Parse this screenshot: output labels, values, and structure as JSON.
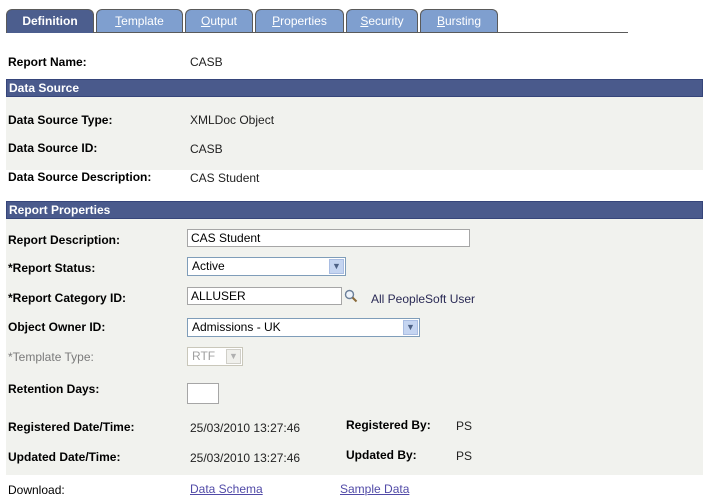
{
  "tabs": [
    {
      "label": "Definition",
      "active": true
    },
    {
      "label": "Template",
      "mnemonic": "T",
      "rest": "emplate"
    },
    {
      "label": "Output",
      "mnemonic": "O",
      "rest": "utput"
    },
    {
      "label": "Properties",
      "mnemonic": "P",
      "rest": "roperties"
    },
    {
      "label": "Security",
      "mnemonic": "S",
      "rest": "ecurity"
    },
    {
      "label": "Bursting",
      "mnemonic": "B",
      "rest": "ursting"
    }
  ],
  "report_name": {
    "label": "Report Name:",
    "value": "CASB"
  },
  "data_source": {
    "header": "Data Source",
    "type": {
      "label": "Data Source Type:",
      "value": "XMLDoc Object"
    },
    "id": {
      "label": "Data Source ID:",
      "value": "CASB"
    },
    "description": {
      "label": "Data Source Description:",
      "value": "CAS Student"
    }
  },
  "report_properties": {
    "header": "Report Properties",
    "description": {
      "label": "Report Description:",
      "value": "CAS Student"
    },
    "status": {
      "label": "*Report Status:",
      "value": "Active"
    },
    "category": {
      "label": "*Report Category ID:",
      "value": "ALLUSER",
      "description": "All PeopleSoft User"
    },
    "owner": {
      "label": "Object Owner ID:",
      "value": "Admissions - UK"
    },
    "template_type": {
      "label": "*Template Type:",
      "value": "RTF"
    },
    "retention": {
      "label": "Retention Days:",
      "value": ""
    },
    "registered": {
      "label": "Registered Date/Time:",
      "value": "25/03/2010 13:27:46",
      "by_label": "Registered By:",
      "by_value": "PS"
    },
    "updated": {
      "label": "Updated Date/Time:",
      "value": "25/03/2010 13:27:46",
      "by_label": "Updated By:",
      "by_value": "PS"
    }
  },
  "download": {
    "label": "Download:",
    "links": [
      "Data Schema",
      "Sample Data"
    ]
  },
  "icons": {
    "lookup": "magnifier-icon",
    "dropdown": "chevron-down-icon"
  },
  "colors": {
    "section_header": "#4a5a8c",
    "tab_active": "#4c5e8e",
    "tab_inactive": "#7f9fcf",
    "panel": "#f1f2ee",
    "link": "#514aa7"
  }
}
